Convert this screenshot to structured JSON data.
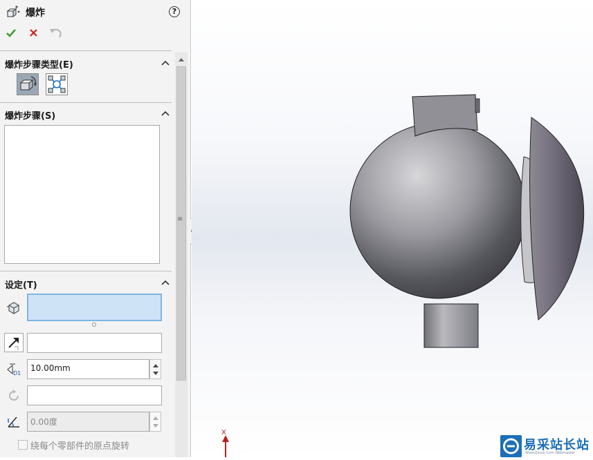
{
  "header": {
    "title": "爆炸",
    "help_glyph": "?"
  },
  "sections": {
    "step_type": {
      "title": "爆炸步骤类型(E)"
    },
    "steps": {
      "title": "爆炸步骤(S)"
    },
    "settings": {
      "title": "设定(T)",
      "distance_value": "10.00mm",
      "angle_value": "0.00度",
      "rotate_about_origin_label": "绕每个零部件的原点旋转"
    }
  },
  "viewport": {
    "triad_axis_label": "X"
  },
  "watermark": {
    "text": "易采站长站",
    "subtext": "Www.Easck.Com Webmaster"
  },
  "colors": {
    "accept_green": "#3a9a2e",
    "cancel_red": "#c8221c",
    "selection_fill": "#cfe3f6",
    "watermark_blue": "#1c6fb8"
  },
  "icons": {
    "title": "explode-icon",
    "ok": "checkmark-icon",
    "cancel": "x-icon",
    "undo": "undo-arrow-icon"
  }
}
